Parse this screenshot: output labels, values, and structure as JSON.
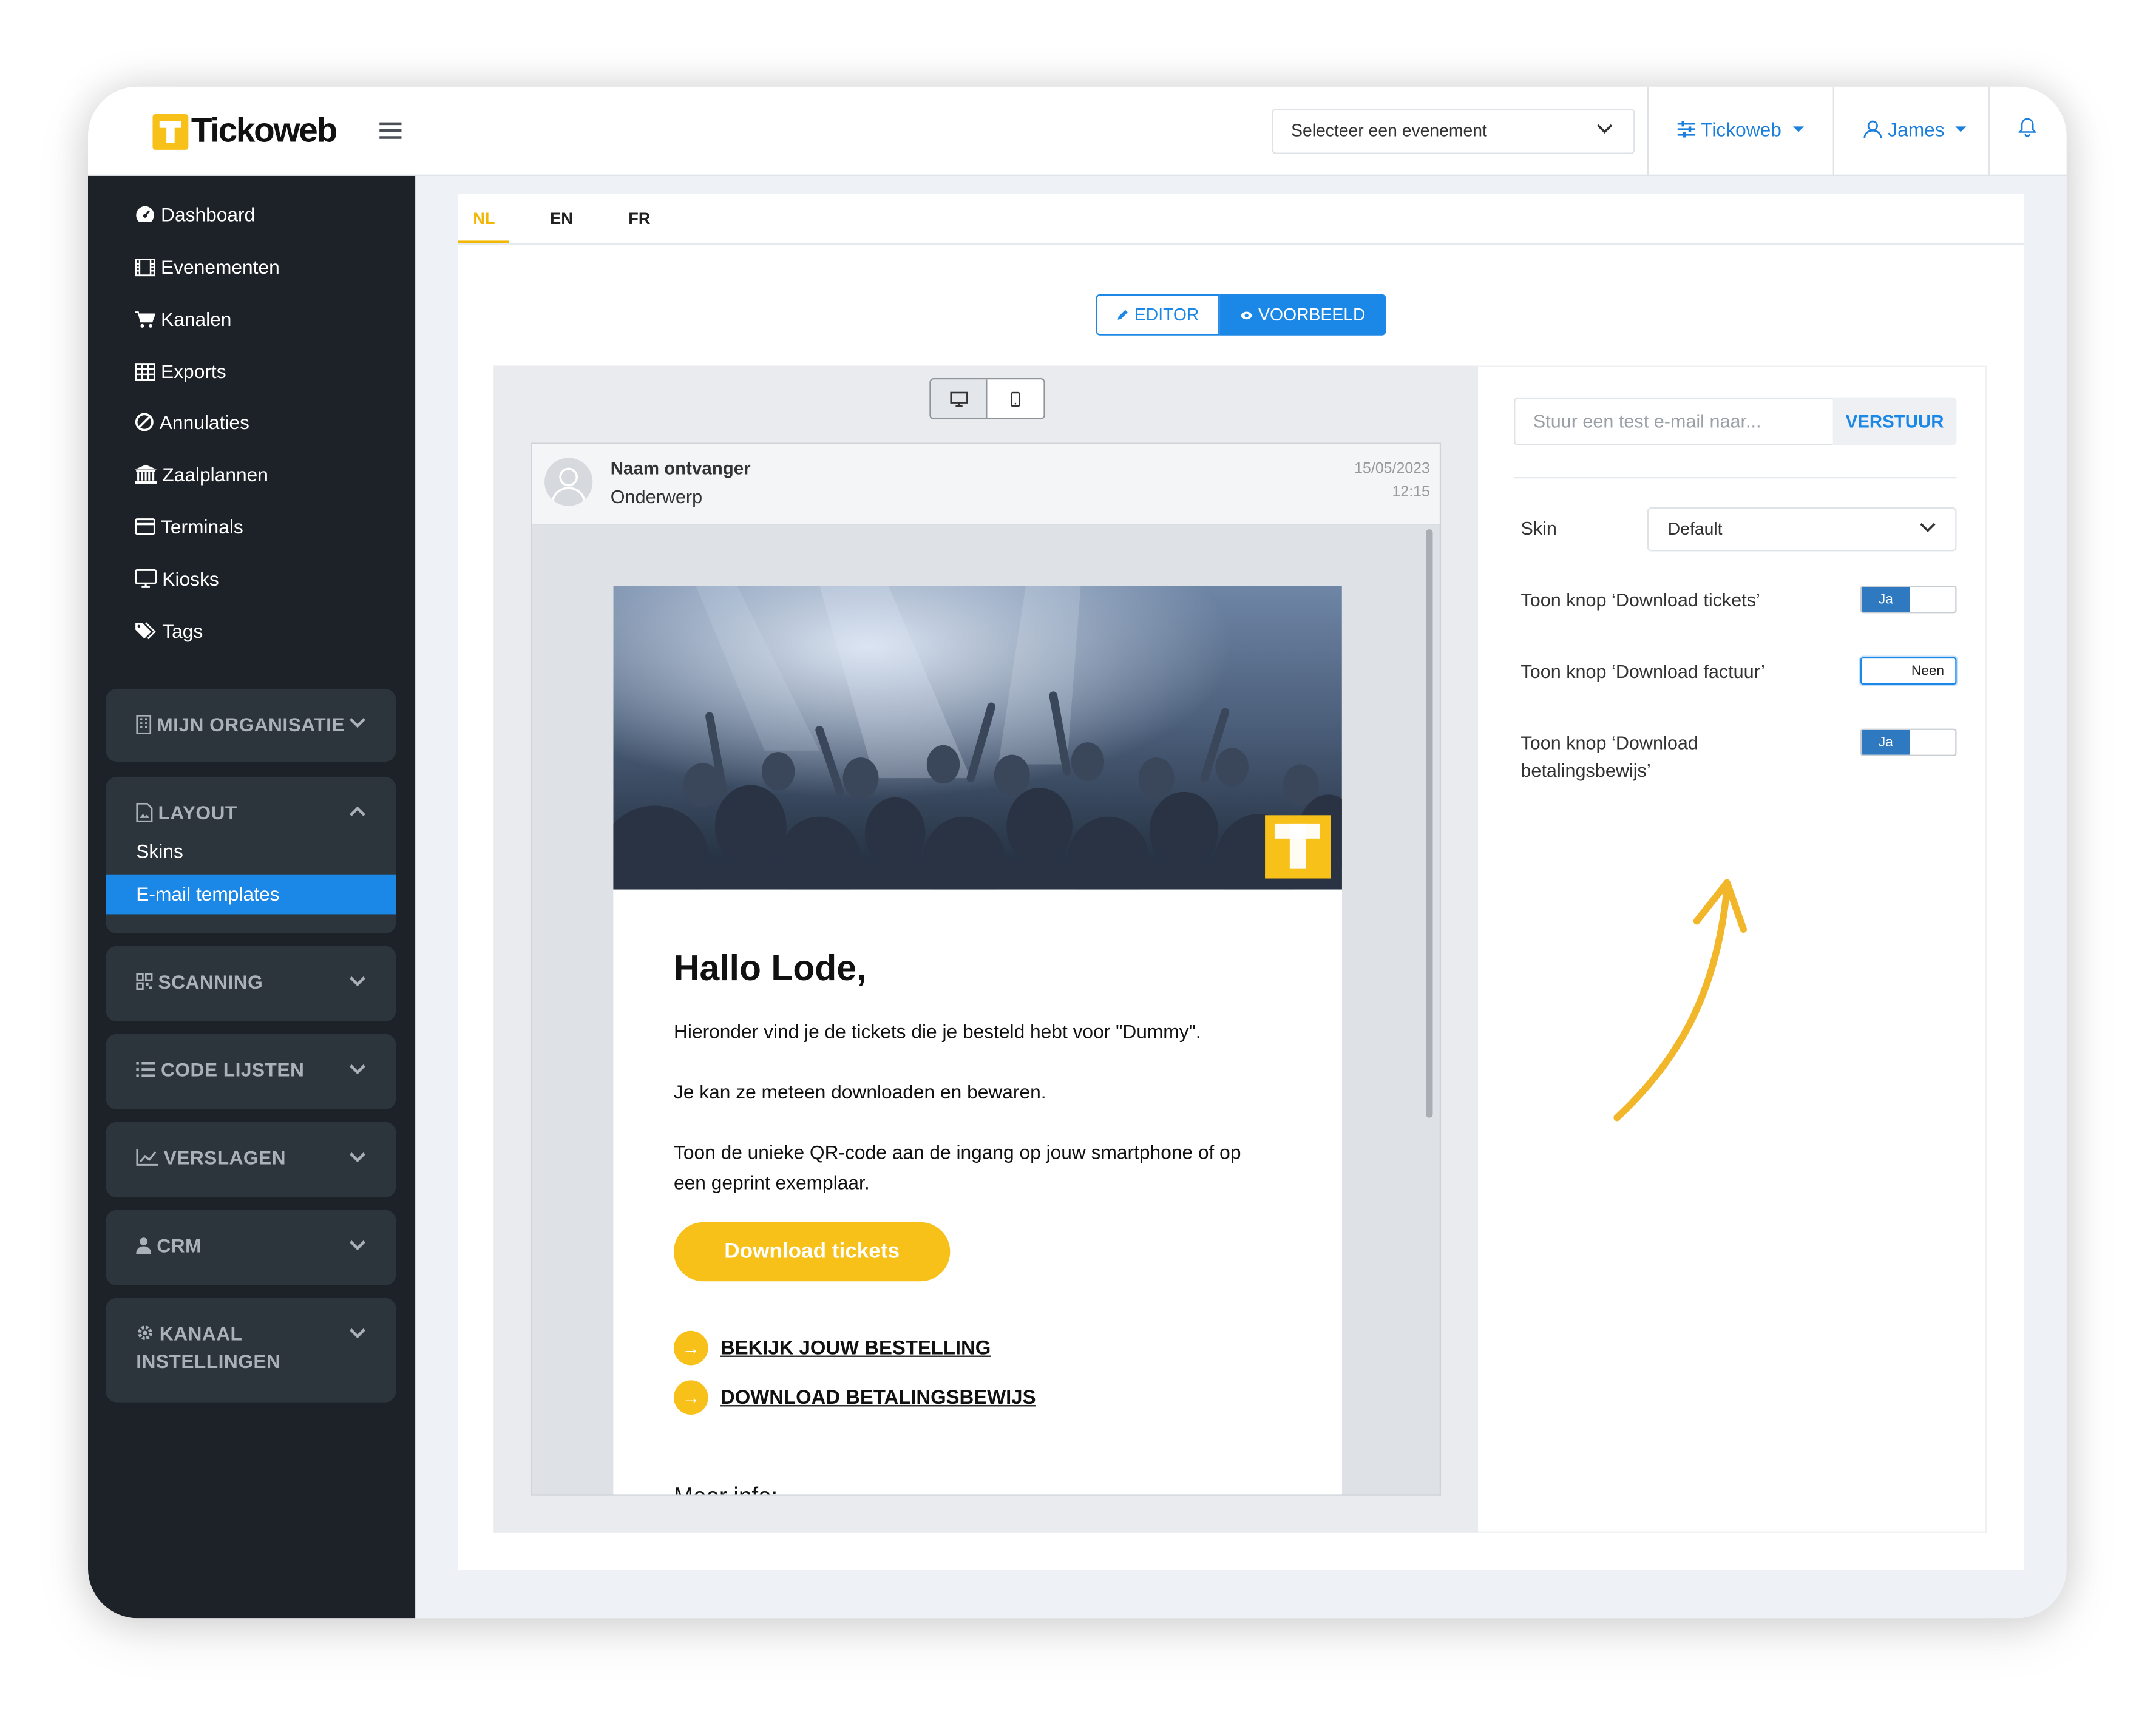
{
  "brand": {
    "name": "Tickoweb",
    "accent": "#f7c11a",
    "primary": "#1b87e6"
  },
  "topbar": {
    "event_select": {
      "value": "Selecteer een evenement"
    },
    "org_menu": {
      "label": "Tickoweb",
      "icon": "sliders-icon"
    },
    "user_menu": {
      "label": "James",
      "icon": "user-icon"
    },
    "notifications_icon": "bell-icon"
  },
  "sidebar": {
    "items": [
      {
        "label": "Dashboard",
        "icon": "dashboard-icon"
      },
      {
        "label": "Evenementen",
        "icon": "film-icon"
      },
      {
        "label": "Kanalen",
        "icon": "cart-icon"
      },
      {
        "label": "Exports",
        "icon": "table-icon"
      },
      {
        "label": "Annulaties",
        "icon": "ban-icon"
      },
      {
        "label": "Zaalplannen",
        "icon": "building-icon"
      },
      {
        "label": "Terminals",
        "icon": "card-icon"
      },
      {
        "label": "Kiosks",
        "icon": "monitor-icon"
      },
      {
        "label": "Tags",
        "icon": "tags-icon"
      }
    ],
    "groups": [
      {
        "label": "MIJN ORGANISATIE",
        "expanded": false
      },
      {
        "label": "LAYOUT",
        "expanded": true,
        "children": [
          "Skins",
          "E-mail templates"
        ],
        "active_child": "E-mail templates"
      },
      {
        "label": "SCANNING",
        "expanded": false
      },
      {
        "label": "CODE LIJSTEN",
        "expanded": false
      },
      {
        "label": "VERSLAGEN",
        "expanded": false
      },
      {
        "label": "CRM",
        "expanded": false
      },
      {
        "label": "KANAAL INSTELLINGEN",
        "line1": "KANAAL",
        "line2": "INSTELLINGEN",
        "expanded": false
      }
    ]
  },
  "main": {
    "lang_tabs": [
      "NL",
      "EN",
      "FR"
    ],
    "active_lang": "NL",
    "mode_buttons": {
      "editor": "EDITOR",
      "preview": "VOORBEELD",
      "active": "VOORBEELD"
    },
    "device_buttons": {
      "desktop_icon": "desktop-icon",
      "mobile_icon": "mobile-icon",
      "active": "desktop"
    }
  },
  "email": {
    "sender": "Naam ontvanger",
    "subject": "Onderwerp",
    "date": "15/05/2023",
    "time": "12:15",
    "greeting": "Hallo Lode,",
    "paragraph_1": "Hieronder vind je de tickets die je besteld hebt voor \"Dummy\".",
    "paragraph_2": "Je kan ze meteen downloaden en bewaren.",
    "paragraph_3": "Toon de unieke QR-code aan de ingang op jouw smartphone of op een geprint exemplaar.",
    "cta_label": "Download tickets",
    "links": [
      "BEKIJK JOUW BESTELLING",
      "DOWNLOAD BETALINGSBEWIJS"
    ],
    "more_info": "Meer info:"
  },
  "settings": {
    "test_email_placeholder": "Stuur een test e-mail naar...",
    "send_label": "VERSTUUR",
    "skin_label": "Skin",
    "skin_value": "Default",
    "toggles": [
      {
        "label": "Toon knop ‘Download tickets’",
        "value": "Ja",
        "on": true
      },
      {
        "label": "Toon knop ‘Download factuur’",
        "value": "Neen",
        "on": false
      },
      {
        "label_line1": "Toon knop ‘Download",
        "label_line2": "betalingsbewijs’",
        "value": "Ja",
        "on": true
      }
    ]
  }
}
